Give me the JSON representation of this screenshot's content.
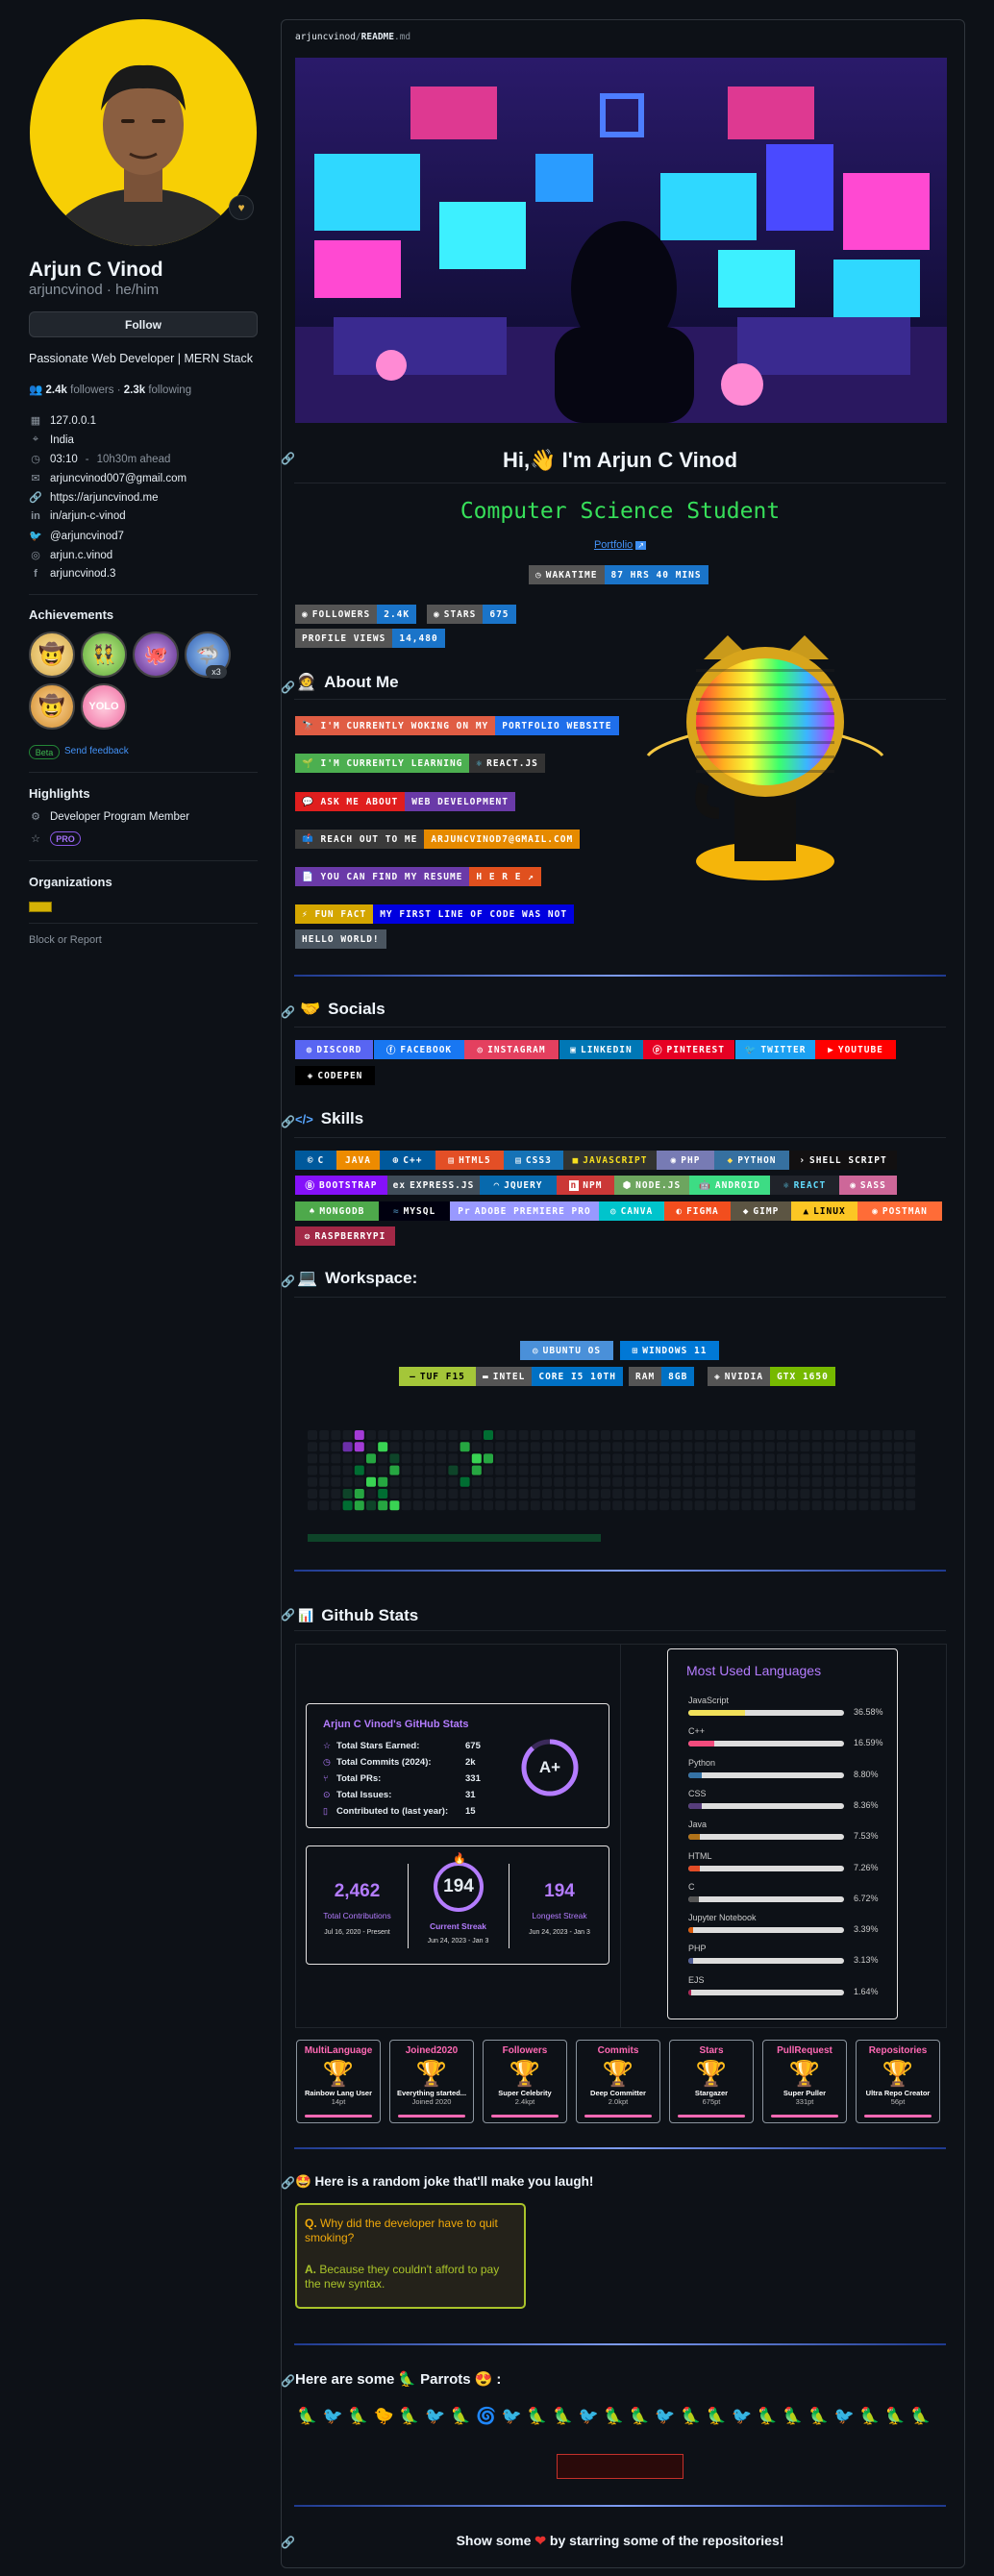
{
  "profile": {
    "display_name": "Arjun C Vinod",
    "username": "arjuncvinod",
    "pronouns": "he/him",
    "follow_label": "Follow",
    "bio": "Passionate Web Developer | MERN Stack",
    "followers_count": "2.4k",
    "followers_label": "followers",
    "following_count": "2.3k",
    "following_label": "following",
    "location_ip": "127.0.0.1",
    "country": "India",
    "local_time": "03:10",
    "time_note": "10h30m ahead",
    "email": "arjuncvinod007@gmail.com",
    "website": "https://arjuncvinod.me",
    "linkedin": "in/arjun-c-vinod",
    "twitter": "@arjuncvinod7",
    "instagram": "arjun.c.vinod",
    "facebook": "arjuncvinod.3",
    "status_emoji": "🟡"
  },
  "achievements": {
    "title": "Achievements",
    "extra_count": "x3",
    "beta_label": "Beta",
    "feedback_label": "Send feedback"
  },
  "highlights": {
    "title": "Highlights",
    "program": "Developer Program Member",
    "pro_label": "PRO"
  },
  "organizations": {
    "title": "Organizations",
    "block_label": "Block or Report"
  },
  "readme": {
    "path_user": "arjuncvinod",
    "path_sep": "/",
    "path_file": "README",
    "path_ext": ".md",
    "greeting": "Hi,👋 I'm Arjun C Vinod",
    "subtitle": "Computer Science Student",
    "portfolio_link": "Portfolio",
    "wakatime_label": "WAKATIME",
    "wakatime_value": "87 HRS 40 MINS",
    "followers_label": "FOLLOWERS",
    "followers_value": "2.4K",
    "stars_label": "STARS",
    "stars_value": "675",
    "profile_views_label": "PROFILE VIEWS",
    "profile_views_value": "14,480"
  },
  "about": {
    "title": "About Me",
    "b1l": "🔭 I'M CURRENTLY WOKING ON MY",
    "b1r": "PORTFOLIO WEBSITE",
    "b2l": "🌱 I'M CURRENTLY LEARNING",
    "b2r": "REACT.JS",
    "b3l": "💬 ASK ME ABOUT",
    "b3r": "WEB DEVELOPMENT",
    "b4l": "📫 REACH OUT TO ME",
    "b4r": "ARJUNCVINOD7@GMAIL.COM",
    "b5l": "📄 YOU CAN FIND MY RESUME",
    "b5r": "H E R E ↗",
    "b6l": "⚡ FUN FACT",
    "b6r": "MY FIRST LINE OF CODE WAS NOT",
    "b7": "HELLO WORLD!"
  },
  "socials": {
    "title": "Socials",
    "discord": "DISCORD",
    "facebook": "FACEBOOK",
    "instagram": "INSTAGRAM",
    "linkedin": "LINKEDIN",
    "pinterest": "PINTEREST",
    "twitter": "TWITTER",
    "youtube": "YOUTUBE",
    "codepen": "CODEPEN"
  },
  "skills": {
    "title": "Skills",
    "c": "C",
    "java": "JAVA",
    "cpp": "C++",
    "html5": "HTML5",
    "css3": "CSS3",
    "javascript": "JAVASCRIPT",
    "php": "PHP",
    "python": "PYTHON",
    "shell": "SHELL SCRIPT",
    "bootstrap": "BOOTSTRAP",
    "express": "EXPRESS.JS",
    "jquery": "JQUERY",
    "npm": "NPM",
    "node": "NODE.JS",
    "android": "ANDROID",
    "react": "REACT",
    "sass": "SASS",
    "mongodb": "MONGODB",
    "mysql": "MYSQL",
    "premiere": "ADOBE PREMIERE PRO",
    "canva": "CANVA",
    "figma": "FIGMA",
    "gimp": "GIMP",
    "linux": "LINUX",
    "postman": "POSTMAN",
    "raspberry": "RASPBERRYPI"
  },
  "workspace": {
    "title": "Workspace:",
    "ubuntu": "UBUNTU OS",
    "windows": "WINDOWS 11",
    "tuf": "TUF F15",
    "intel_label": "INTEL",
    "intel_value": "CORE I5 10TH",
    "ram_label": "RAM",
    "ram_value": "8GB",
    "nvidia_label": "NVIDIA",
    "nvidia_value": "GTX 1650"
  },
  "github_stats": {
    "title": "Github Stats",
    "card_title": "Arjun C Vinod's GitHub Stats",
    "stars_label": "Total Stars Earned:",
    "stars_value": "675",
    "commits_label": "Total Commits (2024):",
    "commits_value": "2k",
    "prs_label": "Total PRs:",
    "prs_value": "331",
    "issues_label": "Total Issues:",
    "issues_value": "31",
    "contrib_label": "Contributed to (last year):",
    "contrib_value": "15",
    "grade": "A+",
    "total_contrib_value": "2,462",
    "total_contrib_label": "Total Contributions",
    "total_contrib_range": "Jul 16, 2020 - Present",
    "current_streak_value": "194",
    "current_streak_label": "Current Streak",
    "current_streak_range": "Jun 24, 2023 - Jan 3",
    "longest_streak_value": "194",
    "longest_streak_label": "Longest Streak",
    "longest_streak_range": "Jun 24, 2023 - Jan 3",
    "langs_title": "Most Used Languages",
    "languages": [
      {
        "name": "JavaScript",
        "pct": "36.58%",
        "value": 36.58,
        "color": "#f1e05a"
      },
      {
        "name": "C++",
        "pct": "16.59%",
        "value": 16.59,
        "color": "#f34b7d"
      },
      {
        "name": "Python",
        "pct": "8.80%",
        "value": 8.8,
        "color": "#3572A5"
      },
      {
        "name": "CSS",
        "pct": "8.36%",
        "value": 8.36,
        "color": "#563d7c"
      },
      {
        "name": "Java",
        "pct": "7.53%",
        "value": 7.53,
        "color": "#b07219"
      },
      {
        "name": "HTML",
        "pct": "7.26%",
        "value": 7.26,
        "color": "#e34c26"
      },
      {
        "name": "C",
        "pct": "6.72%",
        "value": 6.72,
        "color": "#555555"
      },
      {
        "name": "Jupyter Notebook",
        "pct": "3.39%",
        "value": 3.39,
        "color": "#DA5B0B"
      },
      {
        "name": "PHP",
        "pct": "3.13%",
        "value": 3.13,
        "color": "#4F5D95"
      },
      {
        "name": "EJS",
        "pct": "1.64%",
        "value": 1.64,
        "color": "#a91e50"
      }
    ]
  },
  "trophies": [
    {
      "title": "MultiLanguage",
      "desc": "Rainbow Lang User",
      "pts": "14pt"
    },
    {
      "title": "Joined2020",
      "desc": "Everything started...",
      "pts": "Joined 2020"
    },
    {
      "title": "Followers",
      "desc": "Super Celebrity",
      "pts": "2.4kpt"
    },
    {
      "title": "Commits",
      "desc": "Deep Committer",
      "pts": "2.0kpt"
    },
    {
      "title": "Stars",
      "desc": "Stargazer",
      "pts": "675pt"
    },
    {
      "title": "PullRequest",
      "desc": "Super Puller",
      "pts": "331pt"
    },
    {
      "title": "Repositories",
      "desc": "Ultra Repo Creator",
      "pts": "56pt"
    }
  ],
  "joke": {
    "title": "🤩 Here is a random joke that'll make you laugh!",
    "q_prefix": "Q.",
    "question": "Why did the developer have to quit smoking?",
    "a_prefix": "A.",
    "answer": "Because they couldn't afford to pay the new syntax."
  },
  "parrots": {
    "title_a": "Here are some",
    "title_b": "Parrots",
    "title_c": ":"
  },
  "footer": {
    "text_a": "Show some",
    "text_b": "by starring some of the repositories!"
  }
}
